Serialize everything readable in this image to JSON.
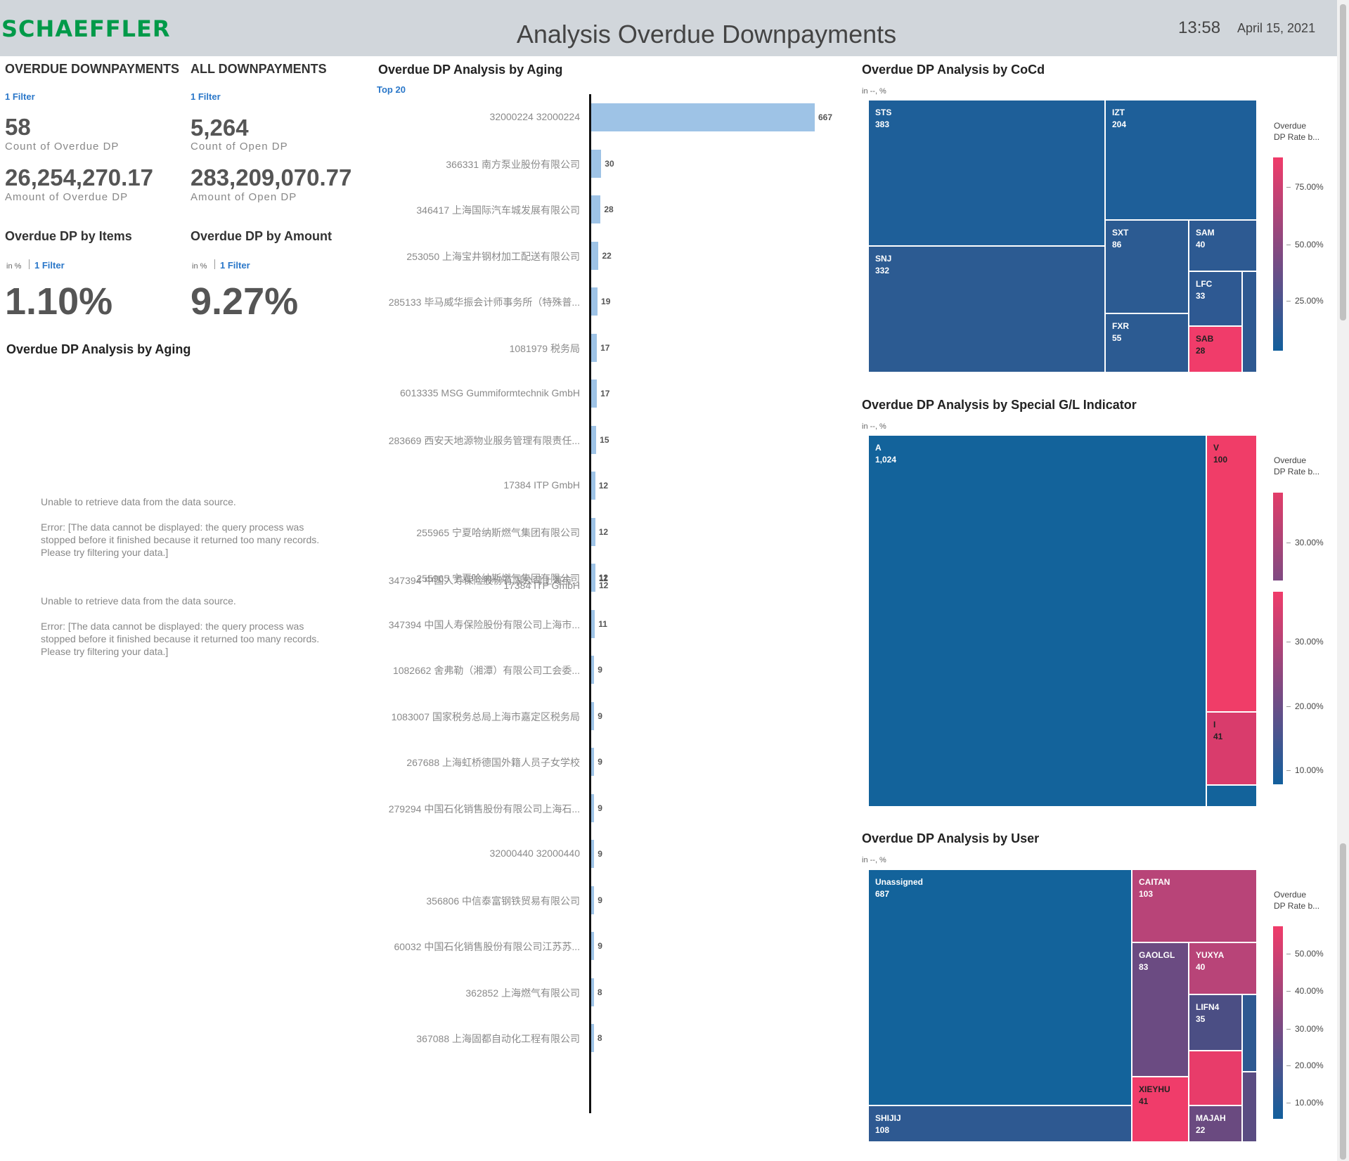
{
  "header": {
    "logo": "SCHAEFFLER",
    "title": "Analysis Overdue Downpayments",
    "time": "13:58",
    "date": "April 15, 2021"
  },
  "kpi": {
    "overdue": {
      "heading": "OVERDUE DOWNPAYMENTS",
      "filter": "1 Filter",
      "count": "58",
      "count_label": "Count of Overdue DP",
      "amount": "26,254,270.17",
      "amount_label": "Amount of Overdue DP"
    },
    "all": {
      "heading": "ALL DOWNPAYMENTS",
      "filter": "1 Filter",
      "count": "5,264",
      "count_label": "Count of Open DP",
      "amount": "283,209,070.77",
      "amount_label": "Amount of Open DP"
    },
    "by_items": {
      "heading": "Overdue DP by Items",
      "unit": "in %",
      "filter": "1 Filter",
      "value": "1.10%"
    },
    "by_amount": {
      "heading": "Overdue DP by Amount",
      "unit": "in %",
      "filter": "1 Filter",
      "value": "9.27%"
    }
  },
  "aging_left": {
    "title": "Overdue DP Analysis by Aging",
    "errors": [
      {
        "line1": "Unable to retrieve data from the data source.",
        "line2": "Error: [The data cannot be displayed: the query process was stopped before it finished because it returned too many records. Please try filtering your data.]"
      },
      {
        "line1": "Unable to retrieve data from the data source.",
        "line2": "Error: [The data cannot be displayed: the query process was stopped before it finished because it returned too many records. Please try filtering your data.]"
      }
    ]
  },
  "aging_bar": {
    "title": "Overdue DP Analysis by Aging",
    "filter": "Top 20",
    "overlap_labels": [
      "347394 中国人寿保险股份有限公司上海市...",
      "17384 ITP GmbH"
    ],
    "overlap_values": [
      "11",
      "12"
    ]
  },
  "chart_data": [
    {
      "type": "bar",
      "title": "Overdue DP Analysis by Aging",
      "categories": [
        "32000224 32000224",
        "366331 南方泵业股份有限公司",
        "346417 上海国际汽车城发展有限公司",
        "253050 上海宝井钢材加工配送有限公司",
        "285133 毕马威华振会计师事务所（特殊普...",
        "1081979 税务局",
        "6013335 MSG Gummiformtechnik GmbH",
        "283669 西安天地源物业服务管理有限责任...",
        "17384 ITP GmbH",
        "255965 宁夏哈纳斯燃气集团有限公司",
        "255965 宁夏哈纳斯燃气集团有限公司",
        "347394 中国人寿保险股份有限公司上海市...",
        "1082662 舍弗勒（湘潭）有限公司工会委...",
        "1083007 国家税务总局上海市嘉定区税务局",
        "267688 上海虹桥德国外籍人员子女学校",
        "279294 中国石化销售股份有限公司上海石...",
        "32000440 32000440",
        "356806 中信泰富钢铁贸易有限公司",
        "60032 中国石化销售股份有限公司江苏苏...",
        "362852 上海燃气有限公司",
        "367088 上海固都自动化工程有限公司"
      ],
      "values": [
        667,
        30,
        28,
        22,
        19,
        17,
        17,
        15,
        12,
        12,
        12,
        11,
        9,
        9,
        9,
        9,
        9,
        9,
        9,
        8,
        8
      ],
      "value_labels": [
        "667",
        "30",
        "28",
        "22",
        "19",
        "17",
        "17",
        "15",
        "12",
        "12",
        "12",
        "11",
        "9",
        "9",
        "9",
        "9",
        "9",
        "9",
        "9",
        "8",
        "8"
      ],
      "orientation": "horizontal",
      "colors": {
        "bar": "#9ec3e6"
      }
    },
    {
      "type": "treemap",
      "title": "Overdue DP Analysis by CoCd",
      "unit": "in --, %",
      "legend_title": [
        "Overdue",
        "DP Rate b..."
      ],
      "legend_ticks": [
        "75.00%",
        "50.00%",
        "25.00%"
      ],
      "tiles": [
        {
          "label": "STS",
          "value": "383",
          "color": "#1e5f99"
        },
        {
          "label": "IZT",
          "value": "204",
          "color": "#1e5f99"
        },
        {
          "label": "SNJ",
          "value": "332",
          "color": "#2c5b92"
        },
        {
          "label": "SXT",
          "value": "86",
          "color": "#2c5b92"
        },
        {
          "label": "SAM",
          "value": "40",
          "color": "#2d5a92"
        },
        {
          "label": "LFC",
          "value": "33",
          "color": "#2e5992"
        },
        {
          "label": "FXR",
          "value": "55",
          "color": "#2c5b92"
        },
        {
          "label": "SAB",
          "value": "28",
          "color": "#f03c6a"
        }
      ]
    },
    {
      "type": "treemap",
      "title": "Overdue DP Analysis by Special G/L Indicator",
      "unit": "in --, %",
      "legend_title": [
        "Overdue",
        "DP Rate b..."
      ],
      "legend_ticks_top": [
        "30.00%"
      ],
      "legend_ticks": [
        "30.00%",
        "20.00%",
        "10.00%"
      ],
      "tiles": [
        {
          "label": "A",
          "value": "1,024",
          "color": "#13639b"
        },
        {
          "label": "V",
          "value": "100",
          "color": "#f03d68"
        },
        {
          "label": "I",
          "value": "41",
          "color": "#d93c6c"
        }
      ]
    },
    {
      "type": "treemap",
      "title": "Overdue DP Analysis by User",
      "unit": "in --, %",
      "legend_title": [
        "Overdue",
        "DP Rate b..."
      ],
      "legend_ticks": [
        "50.00%",
        "40.00%",
        "30.00%",
        "20.00%",
        "10.00%"
      ],
      "tiles": [
        {
          "label": "Unassigned",
          "value": "687",
          "color": "#13639b"
        },
        {
          "label": "CAITAN",
          "value": "103",
          "color": "#b84478"
        },
        {
          "label": "GAOLGL",
          "value": "83",
          "color": "#6b4b82"
        },
        {
          "label": "YUXYA",
          "value": "40",
          "color": "#b84478"
        },
        {
          "label": "LIFN4",
          "value": "35",
          "color": "#4b4e84"
        },
        {
          "label": "SHIJIJ",
          "value": "108",
          "color": "#2e5991"
        },
        {
          "label": "XIEYHU",
          "value": "41",
          "color": "#f03c6a"
        },
        {
          "label": "MAJAH",
          "value": "22",
          "color": "#6a4a80"
        }
      ]
    }
  ]
}
